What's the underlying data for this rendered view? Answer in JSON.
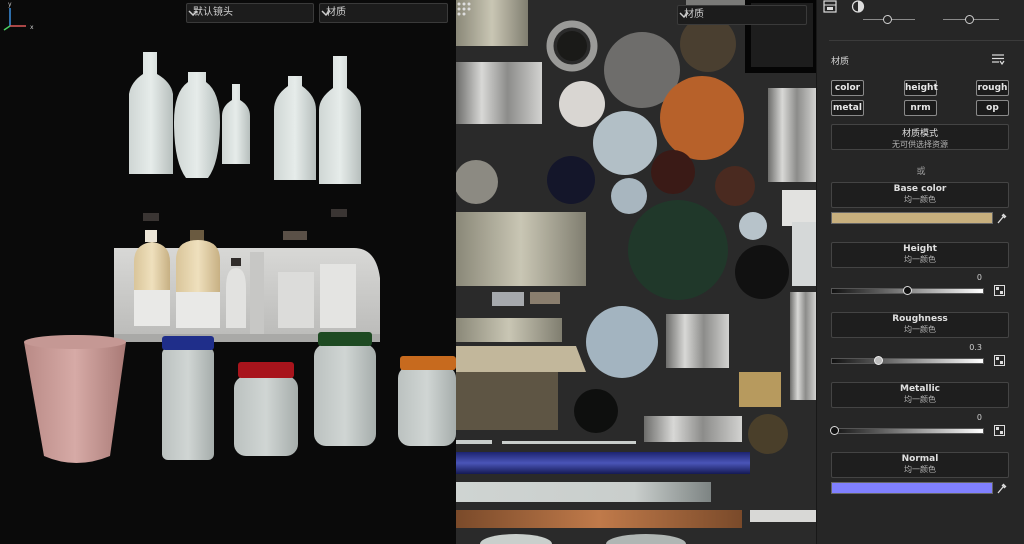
{
  "viewport": {
    "camera_select": "默认镜头",
    "material_select": "材质",
    "axis": {
      "x": "x",
      "y": "y"
    }
  },
  "uv_view": {
    "material_select": "材质"
  },
  "panel": {
    "tabs": [
      "material-tab-icon",
      "sphere-tab-icon"
    ],
    "section_title": "材质",
    "channels": [
      "color",
      "height",
      "rough",
      "metal",
      "nrm",
      "op"
    ],
    "material_mode": {
      "title": "材质模式",
      "subtitle": "无可供选择资源"
    },
    "or_label": "或",
    "base_color": {
      "title": "Base color",
      "subtitle": "均一颜色",
      "swatch": "#c8b07e"
    },
    "height": {
      "title": "Height",
      "subtitle": "均一颜色",
      "value": "0",
      "fraction": 0.5
    },
    "roughness": {
      "title": "Roughness",
      "subtitle": "均一颜色",
      "value": "0.3",
      "fraction": 0.3
    },
    "metallic": {
      "title": "Metallic",
      "subtitle": "均一颜色",
      "value": "0",
      "fraction": 0
    },
    "normal": {
      "title": "Normal",
      "subtitle": "均一颜色",
      "swatch": "#8080ff"
    }
  }
}
